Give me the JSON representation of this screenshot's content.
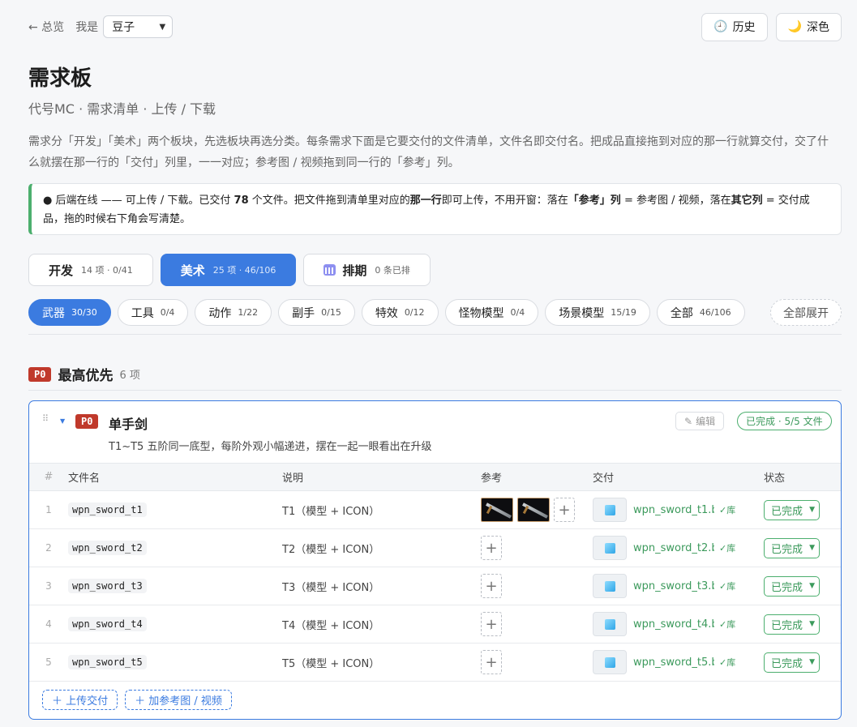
{
  "topbar": {
    "back": "← 总览",
    "me_label": "我是",
    "user": "豆子",
    "history": "历史",
    "history_icon": "clock-icon",
    "dark": "深色",
    "dark_icon": "moon-icon"
  },
  "page": {
    "title": "需求板",
    "subtitle": "代号MC · 需求清单 · 上传 / 下载",
    "desc": "需求分「开发」「美术」两个板块，先选板块再选分类。每条需求下面是它要交付的文件清单，文件名即交付名。把成品直接拖到对应的那一行就算交付，交了什么就摆在那一行的「交付」列里，一一对应；参考图 / 视频拖到同一行的「参考」列。"
  },
  "notice": {
    "p1": "● 后端在线 —— 可上传 / 下载。已交付 ",
    "count": "78",
    "p2": " 个文件。把文件拖到清单里对应的",
    "b1": "那一行",
    "p3": "即可上传，不用开窗：落在",
    "b2": "「参考」列",
    "p4": " = 参考图 / 视频，落在",
    "b3": "其它列",
    "p5": " = 交付成品，拖的时候右下角会写清楚。"
  },
  "boards": [
    {
      "name": "开发",
      "meta": "14 项 · 0/41"
    },
    {
      "name": "美术",
      "meta": "25 项 · 46/106"
    },
    {
      "name": "排期",
      "meta": "0 条已排"
    }
  ],
  "categories": [
    {
      "name": "武器",
      "count": "30/30"
    },
    {
      "name": "工具",
      "count": "0/4"
    },
    {
      "name": "动作",
      "count": "1/22"
    },
    {
      "name": "副手",
      "count": "0/15"
    },
    {
      "name": "特效",
      "count": "0/12"
    },
    {
      "name": "怪物模型",
      "count": "0/4"
    },
    {
      "name": "场景模型",
      "count": "15/19"
    },
    {
      "name": "全部",
      "count": "46/106"
    }
  ],
  "expand_all": "全部展开",
  "section": {
    "badge": "P0",
    "title": "最高优先",
    "count": "6 项"
  },
  "card": {
    "badge": "P0",
    "title": "单手剑",
    "desc": "T1~T5 五阶同一底型，每阶外观小幅递进，摆在一起一眼看出在升级",
    "edit": "编辑",
    "done": "已完成 · 5/5 文件",
    "columns": {
      "idx": "#",
      "file": "文件名",
      "desc": "说明",
      "ref": "参考",
      "deliv": "交付",
      "status": "状态"
    },
    "rows": [
      {
        "idx": "1",
        "file": "wpn_sword_t1",
        "desc": "T1（模型 + ICON）",
        "deliv": "wpn_sword_t1.b...",
        "lib": "✓库",
        "status": "已完成"
      },
      {
        "idx": "2",
        "file": "wpn_sword_t2",
        "desc": "T2（模型 + ICON）",
        "deliv": "wpn_sword_t2.b...",
        "lib": "✓库",
        "status": "已完成"
      },
      {
        "idx": "3",
        "file": "wpn_sword_t3",
        "desc": "T3（模型 + ICON）",
        "deliv": "wpn_sword_t3.b...",
        "lib": "✓库",
        "status": "已完成"
      },
      {
        "idx": "4",
        "file": "wpn_sword_t4",
        "desc": "T4（模型 + ICON）",
        "deliv": "wpn_sword_t4.b...",
        "lib": "✓库",
        "status": "已完成"
      },
      {
        "idx": "5",
        "file": "wpn_sword_t5",
        "desc": "T5（模型 + ICON）",
        "deliv": "wpn_sword_t5.b...",
        "lib": "✓库",
        "status": "已完成"
      }
    ],
    "upload": "＋ 上传交付",
    "add_ref": "＋ 加参考图 / 视频"
  }
}
